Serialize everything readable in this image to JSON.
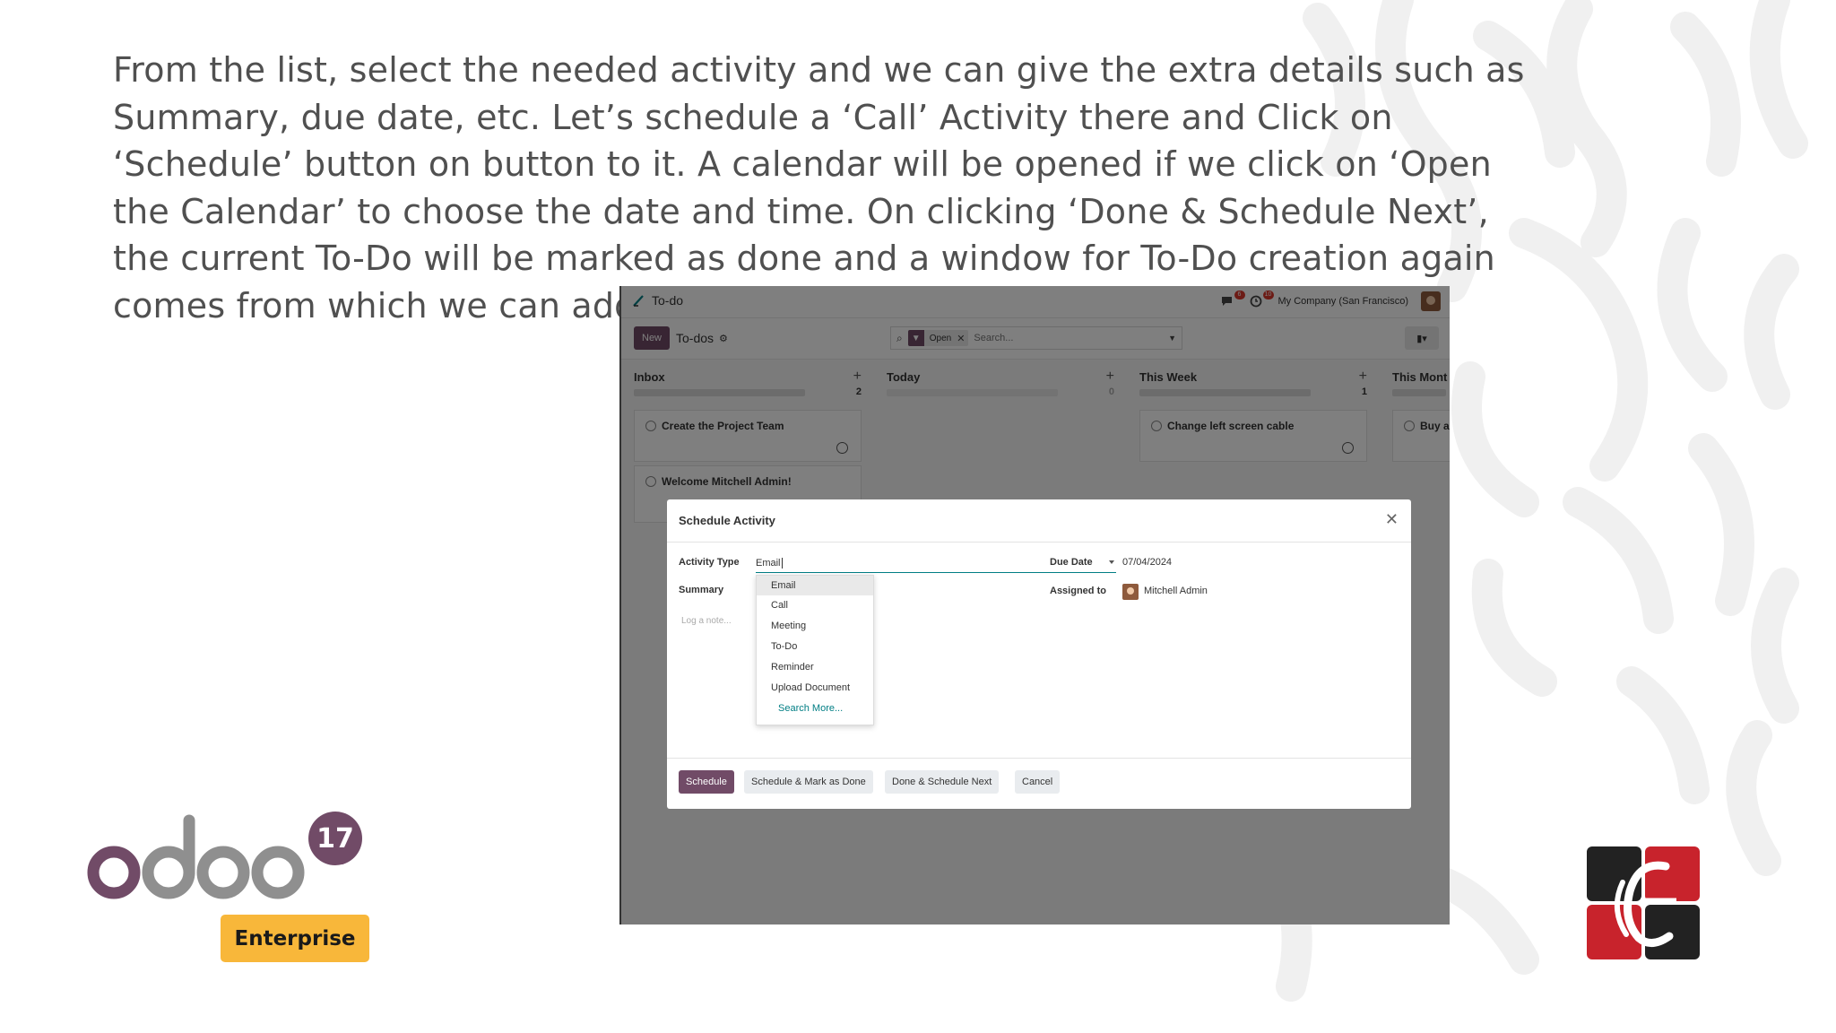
{
  "slide": {
    "paragraph": "From the list, select the needed activity and we can give the extra details such as Summary, due date, etc. Let’s schedule a ‘Call’ Activity there and Click on ‘Schedule’ button on button to it. A calendar will be opened if we click on ‘Open the Calendar’ to choose the date and time. On clicking ‘Done & Schedule Next’, the current To-Do will be marked as done and a window for To-Do creation again comes from which we can add the next activity."
  },
  "logo": {
    "wordmark": "odoo",
    "version": "17",
    "edition": "Enterprise",
    "brand_color": "#714B67",
    "badge_color": "#F8B73A"
  },
  "app": {
    "title": "To-do",
    "messages_count": "6",
    "activities_count": "10",
    "company": "My Company (San Francisco)",
    "new_label": "New",
    "breadcrumb": "To-dos",
    "filter_facet": "Open",
    "search_placeholder": "Search..."
  },
  "kanban": {
    "columns": [
      {
        "title": "Inbox",
        "count": "2",
        "cards": [
          "Create the Project Team",
          "Welcome Mitchell Admin!"
        ]
      },
      {
        "title": "Today",
        "count": "0",
        "cards": []
      },
      {
        "title": "This Week",
        "count": "1",
        "cards": [
          "Change left screen cable"
        ]
      },
      {
        "title": "This Mont",
        "count": "",
        "cards": [
          "Buy a"
        ]
      }
    ]
  },
  "dialog": {
    "title": "Schedule Activity",
    "activity_type_label": "Activity Type",
    "activity_type_value": "Email",
    "summary_label": "Summary",
    "log_note_placeholder": "Log a note...",
    "due_date_label": "Due Date",
    "due_date_value": "07/04/2024",
    "assigned_to_label": "Assigned to",
    "assigned_to_value": "Mitchell Admin",
    "options": [
      "Email",
      "Call",
      "Meeting",
      "To-Do",
      "Reminder",
      "Upload Document"
    ],
    "search_more": "Search More...",
    "buttons": {
      "schedule": "Schedule",
      "schedule_mark_done": "Schedule & Mark as Done",
      "done_schedule_next": "Done & Schedule Next",
      "cancel": "Cancel"
    }
  }
}
